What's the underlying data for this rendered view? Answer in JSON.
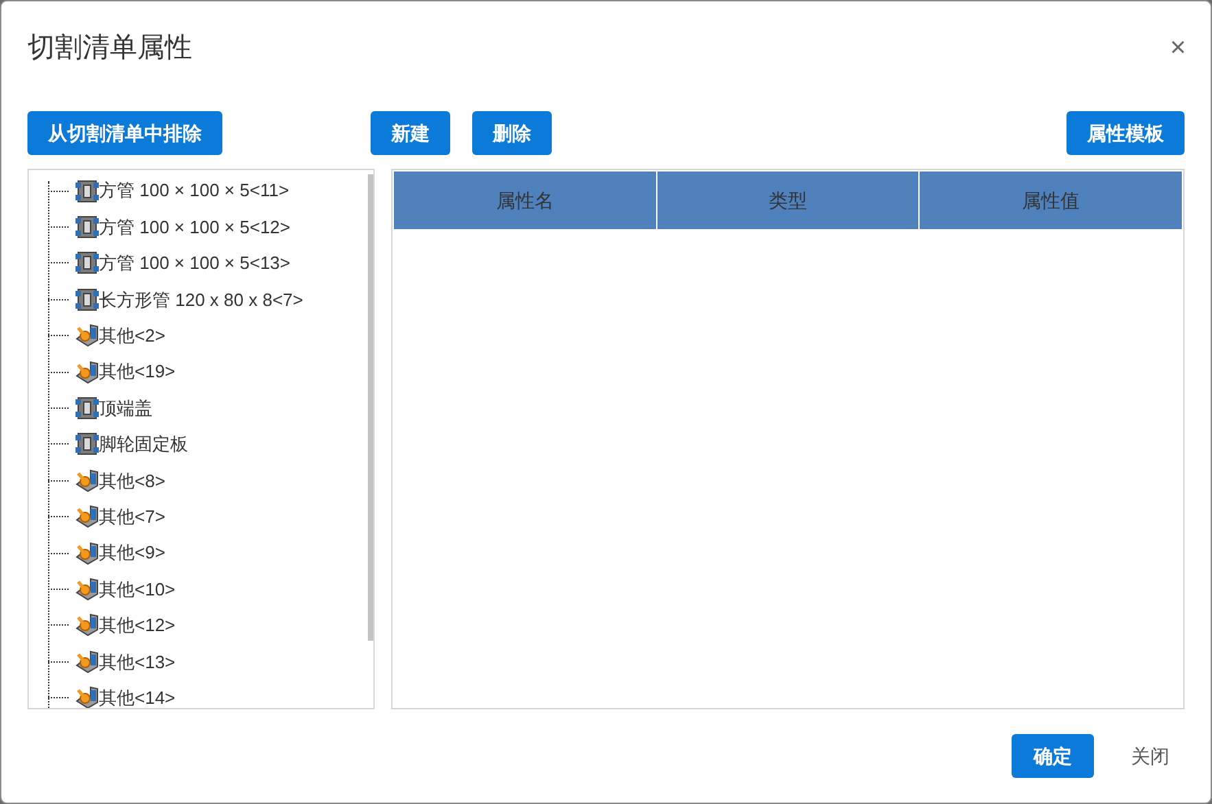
{
  "window": {
    "title": "切割清单属性",
    "close": "×"
  },
  "toolbar": {
    "left": "从切割清单中排除",
    "middle": [
      "新建",
      "删除"
    ],
    "right": "属性模板"
  },
  "tree": {
    "items": [
      {
        "label": "方管 100 × 100 × 5<11>",
        "kind": "part"
      },
      {
        "label": "方管 100 × 100 × 5<12>",
        "kind": "part"
      },
      {
        "label": "方管 100 × 100 × 5<13>",
        "kind": "part"
      },
      {
        "label": "长方形管 120 x 80 x 8<7>",
        "kind": "part"
      },
      {
        "label": "其他<2>",
        "kind": "other"
      },
      {
        "label": "其他<19>",
        "kind": "other"
      },
      {
        "label": "顶端盖",
        "kind": "part"
      },
      {
        "label": "脚轮固定板",
        "kind": "part"
      },
      {
        "label": "其他<8>",
        "kind": "other"
      },
      {
        "label": "其他<7>",
        "kind": "other"
      },
      {
        "label": "其他<9>",
        "kind": "other"
      },
      {
        "label": "其他<10>",
        "kind": "other"
      },
      {
        "label": "其他<12>",
        "kind": "other"
      },
      {
        "label": "其他<13>",
        "kind": "other"
      },
      {
        "label": "其他<14>",
        "kind": "other"
      }
    ]
  },
  "table": {
    "columns": [
      "属性名",
      "类型",
      "属性值"
    ]
  },
  "footer": {
    "ok": "确定",
    "close": "关闭"
  }
}
